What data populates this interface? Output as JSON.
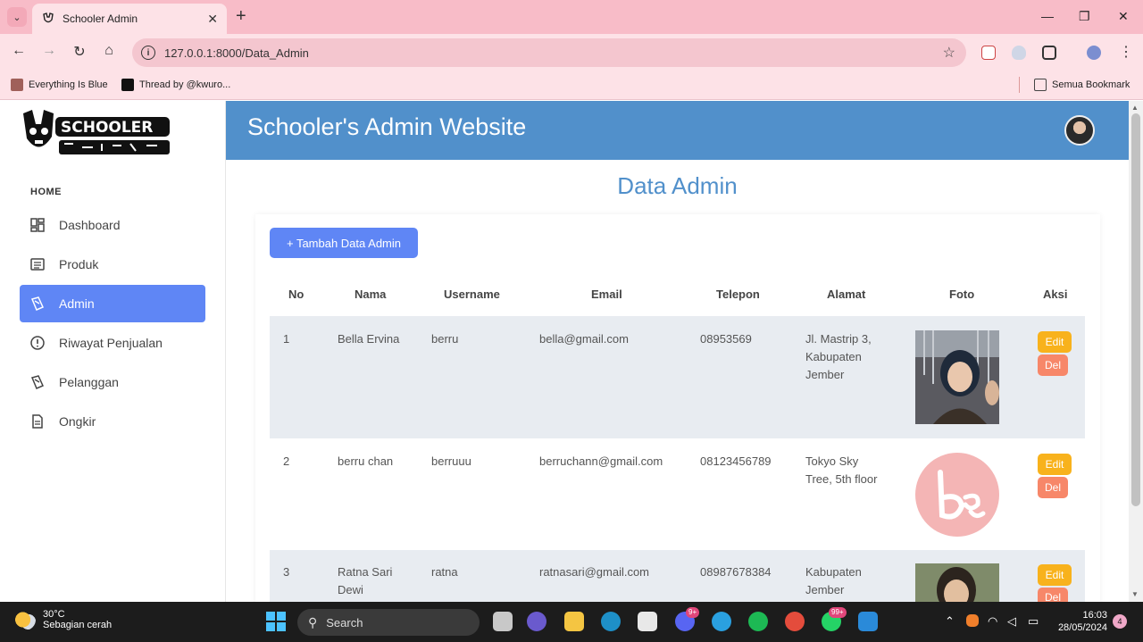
{
  "browser": {
    "tab_title": "Schooler Admin",
    "new_tab": "+",
    "url": "127.0.0.1:8000/Data_Admin",
    "bookmarks": [
      {
        "label": "Everything Is Blue"
      },
      {
        "label": "Thread by @kwuro..."
      }
    ],
    "all_bookmarks": "Semua Bookmark"
  },
  "sidebar": {
    "section_label": "HOME",
    "items": [
      {
        "label": "Dashboard",
        "icon": "dashboard-icon"
      },
      {
        "label": "Produk",
        "icon": "list-icon"
      },
      {
        "label": "Admin",
        "icon": "admin-icon",
        "active": true
      },
      {
        "label": "Riwayat Penjualan",
        "icon": "alert-circle-icon"
      },
      {
        "label": "Pelanggan",
        "icon": "customer-icon"
      },
      {
        "label": "Ongkir",
        "icon": "file-icon"
      }
    ]
  },
  "header": {
    "title": "Schooler's Admin Website"
  },
  "main": {
    "page_title": "Data Admin",
    "add_button": "+ Tambah Data Admin",
    "columns": [
      "No",
      "Nama",
      "Username",
      "Email",
      "Telepon",
      "Alamat",
      "Foto",
      "Aksi"
    ],
    "rows": [
      {
        "no": "1",
        "nama": "Bella Ervina",
        "username": "berru",
        "email": "bella@gmail.com",
        "telepon": "08953569",
        "alamat": [
          "Jl. Mastrip 3,",
          "Kabupaten",
          "Jember"
        ]
      },
      {
        "no": "2",
        "nama": "berru chan",
        "username": "berruuu",
        "email": "berruchann@gmail.com",
        "telepon": "08123456789",
        "alamat": [
          "Tokyo Sky",
          "Tree, 5th floor"
        ]
      },
      {
        "no": "3",
        "nama": "Ratna Sari Dewi",
        "nama_lines": [
          "Ratna Sari",
          "Dewi"
        ],
        "username": "ratna",
        "email": "ratnasari@gmail.com",
        "telepon": "08987678384",
        "alamat": [
          "Kabupaten",
          "Jember"
        ]
      }
    ],
    "edit_label": "Edit",
    "del_label": "Del"
  },
  "taskbar": {
    "temperature": "30°C",
    "weather": "Sebagian cerah",
    "search": "Search",
    "discord_badge": "9+",
    "whatsapp_badge": "99+",
    "time": "16:03",
    "date": "28/05/2024",
    "notifications": "4"
  },
  "colors": {
    "header": "#5190cb",
    "accent": "#5f86f5",
    "edit": "#f8b21c",
    "del": "#f78769"
  }
}
